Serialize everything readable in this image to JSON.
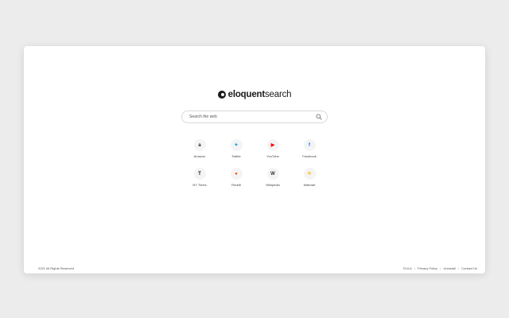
{
  "logo": {
    "prefix": "eloquent",
    "suffix": "search"
  },
  "search": {
    "placeholder": "Search the web",
    "value": ""
  },
  "tiles": [
    {
      "label": "Amazon",
      "icon": "amazon-icon",
      "glyph": "a",
      "color": "#222222"
    },
    {
      "label": "Twitter",
      "icon": "twitter-icon",
      "glyph": "✦",
      "color": "#1d9bf0"
    },
    {
      "label": "YouTube",
      "icon": "youtube-icon",
      "glyph": "▶",
      "color": "#ff0000"
    },
    {
      "label": "Facebook",
      "icon": "facebook-icon",
      "glyph": "f",
      "color": "#1877f2"
    },
    {
      "label": "NY Times",
      "icon": "nytimes-icon",
      "glyph": "T",
      "color": "#111111"
    },
    {
      "label": "Reddit",
      "icon": "reddit-icon",
      "glyph": "●",
      "color": "#ff4500"
    },
    {
      "label": "Wikipedia",
      "icon": "wikipedia-icon",
      "glyph": "W",
      "color": "#333333"
    },
    {
      "label": "Walmart",
      "icon": "walmart-icon",
      "glyph": "✳",
      "color": "#ffc220"
    }
  ],
  "footer": {
    "copyright": "2021 All Rights Reserved",
    "links": [
      "EULA",
      "Privacy Policy",
      "Uninstall",
      "Contact Us"
    ],
    "separator": "•"
  }
}
